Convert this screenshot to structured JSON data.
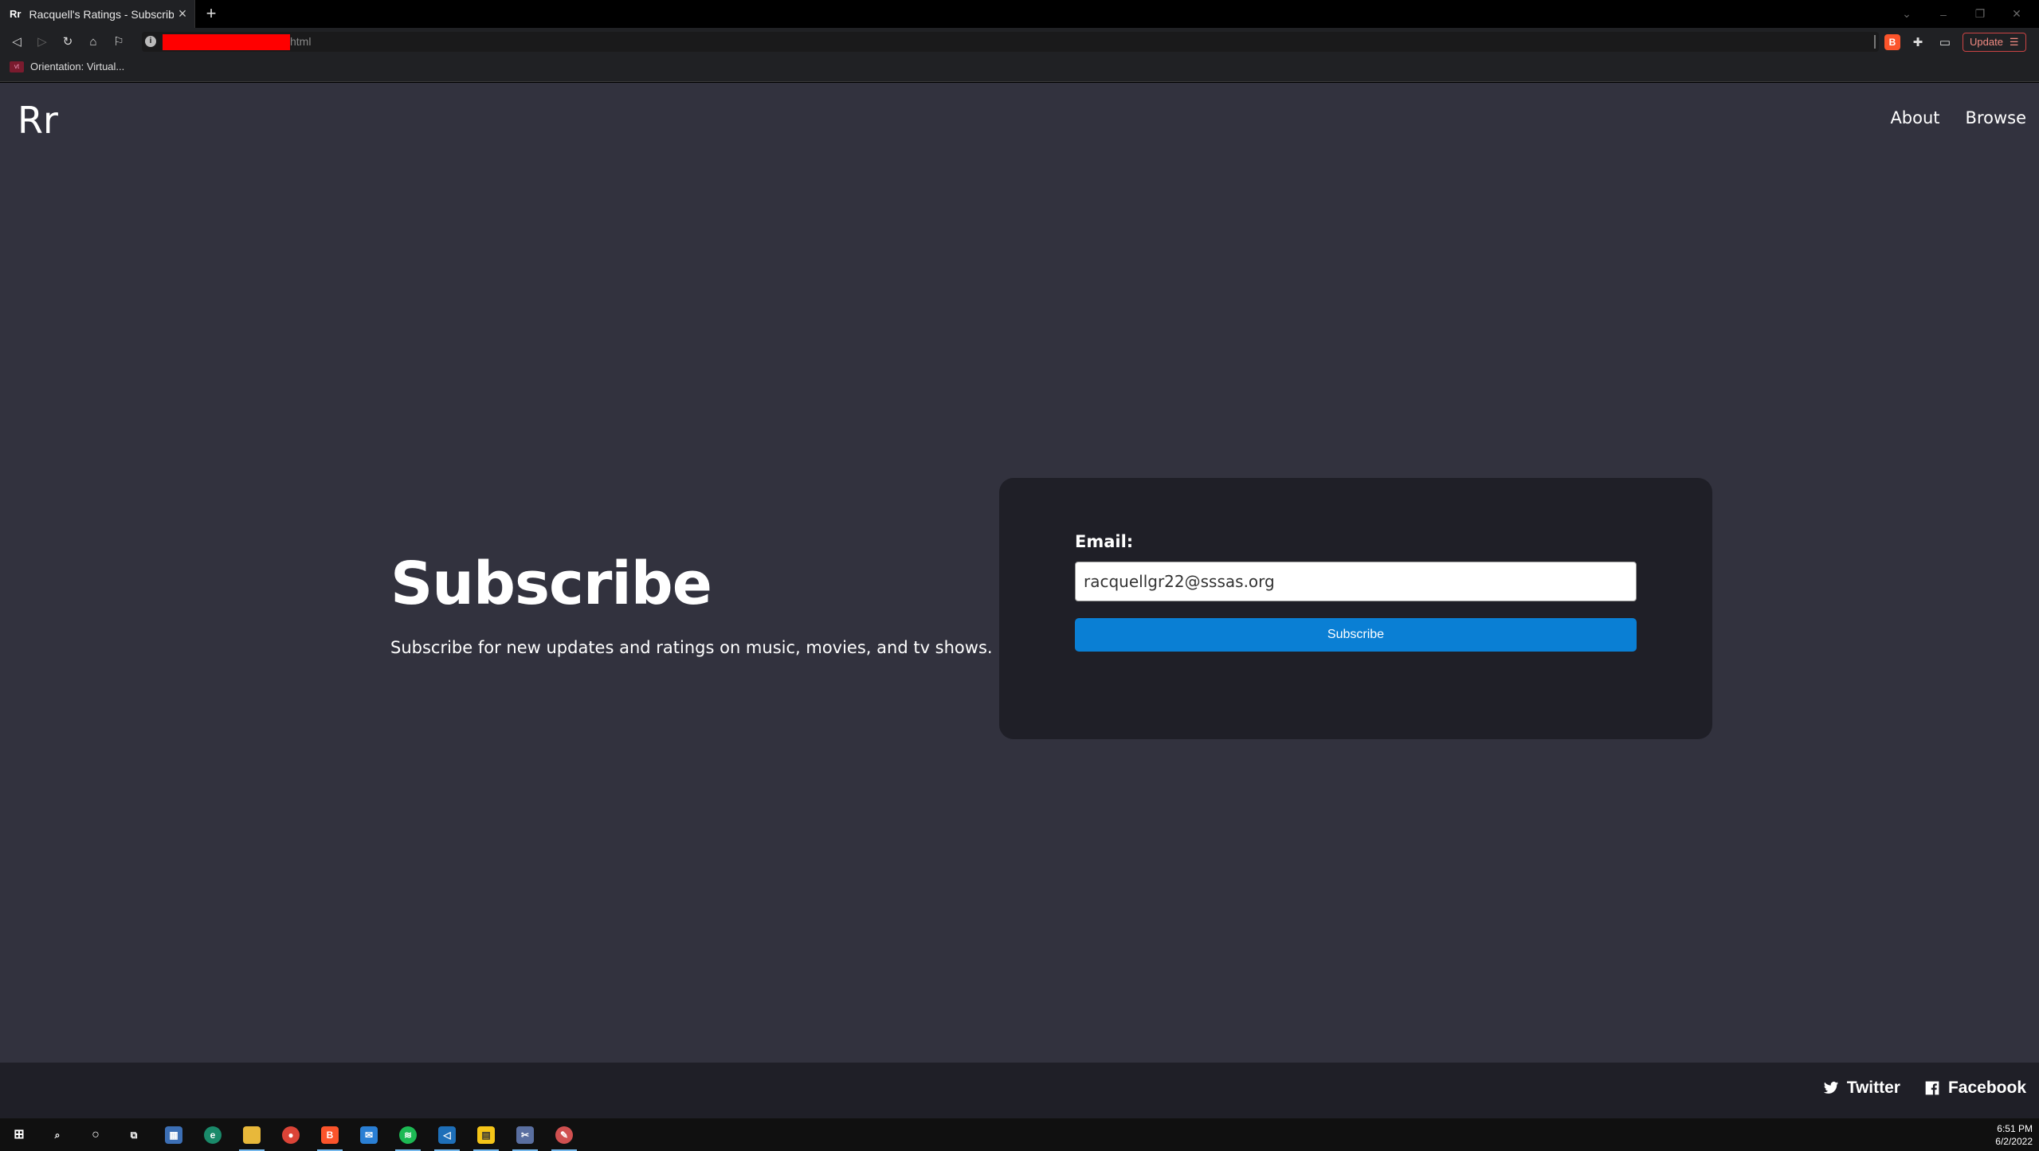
{
  "browser": {
    "tab_favicon": "Rr",
    "tab_title": "Racquell's Ratings - Subscribe",
    "url_suffix": "html",
    "update_label": "Update",
    "bookmark_label": "Orientation: Virtual..."
  },
  "site": {
    "logo": "Rr",
    "nav": {
      "about": "About",
      "browse": "Browse"
    }
  },
  "hero": {
    "title": "Subscribe",
    "subtitle": "Subscribe for new updates and ratings on music, movies, and tv shows."
  },
  "form": {
    "email_label": "Email:",
    "email_value": "racquellgr22@sssas.org",
    "submit_label": "Subscribe"
  },
  "footer": {
    "twitter": "Twitter",
    "facebook": "Facebook"
  },
  "taskbar": {
    "time": "6:51 PM",
    "date": "6/2/2022"
  },
  "colors": {
    "page_bg": "#32323e",
    "card_bg": "#1f1f27",
    "button": "#0a7fd4"
  }
}
